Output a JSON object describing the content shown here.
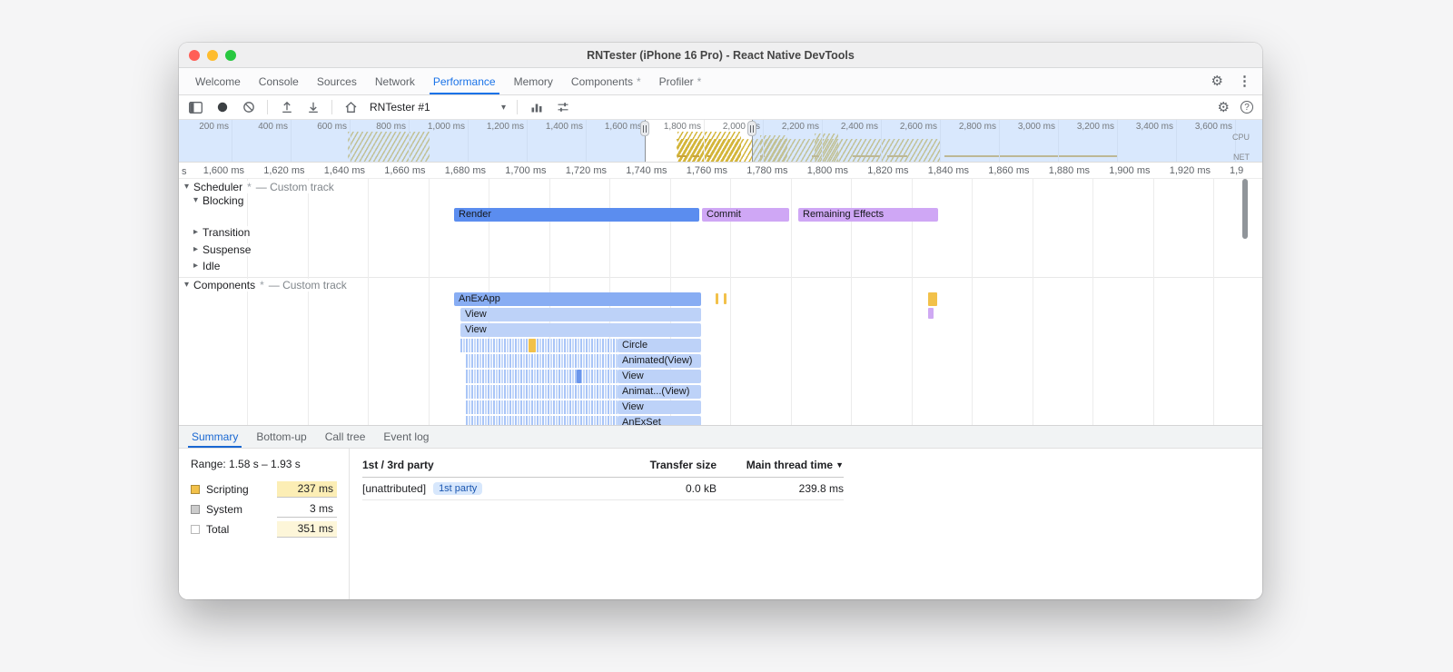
{
  "window": {
    "title": "RNTester (iPhone 16 Pro) - React Native DevTools"
  },
  "devtools_tabs": {
    "badge_char": "*",
    "items": [
      {
        "label": "Welcome"
      },
      {
        "label": "Console"
      },
      {
        "label": "Sources"
      },
      {
        "label": "Network"
      },
      {
        "label": "Performance",
        "selected": true
      },
      {
        "label": "Memory"
      },
      {
        "label": "Components",
        "badge": true
      },
      {
        "label": "Profiler",
        "badge": true
      }
    ]
  },
  "toolbar": {
    "target_select": "RNTester #1",
    "caret": "▾"
  },
  "icons": {
    "settings": "⚙",
    "more": "⋮",
    "help": "?"
  },
  "overview": {
    "cpu_label": "CPU",
    "net_label": "NET",
    "ticks": [
      "200 ms",
      "400 ms",
      "600 ms",
      "800 ms",
      "1,000 ms",
      "1,200 ms",
      "1,400 ms",
      "1,600 ms",
      "1,800 ms",
      "2,000 ms",
      "2,200 ms",
      "2,400 ms",
      "2,600 ms",
      "2,800 ms",
      "3,000 ms",
      "3,200 ms",
      "3,400 ms",
      "3,600 ms"
    ]
  },
  "ruler": {
    "ticks": [
      "1,600 ms",
      "1,620 ms",
      "1,640 ms",
      "1,660 ms",
      "1,680 ms",
      "1,700 ms",
      "1,720 ms",
      "1,740 ms",
      "1,760 ms",
      "1,780 ms",
      "1,800 ms",
      "1,820 ms",
      "1,840 ms",
      "1,860 ms",
      "1,880 ms",
      "1,900 ms",
      "1,920 ms",
      "1,9"
    ]
  },
  "tracks": {
    "timings_clipped_label": "s",
    "glyphs": {
      "caret_down": "▾",
      "caret_right": "▸"
    },
    "scheduler": {
      "name": "Scheduler",
      "suffix": "— Custom track",
      "rows": [
        {
          "label": "Blocking",
          "expanded": true
        },
        {
          "label": "Transition",
          "expanded": false
        },
        {
          "label": "Suspense",
          "expanded": false
        },
        {
          "label": "Idle",
          "expanded": false
        }
      ],
      "bars": [
        {
          "label": "Render"
        },
        {
          "label": "Commit"
        },
        {
          "label": "Remaining Effects"
        }
      ]
    },
    "components": {
      "name": "Components",
      "suffix": "— Custom track"
    },
    "flame": {
      "root": "AnExApp",
      "level2": "View",
      "level3": "View",
      "labels": [
        "Circle",
        "Animated(View)",
        "View",
        "Animat...(View)",
        "View",
        "AnExSet"
      ]
    }
  },
  "bottom_tabs": {
    "items": [
      {
        "label": "Summary",
        "selected": true
      },
      {
        "label": "Bottom-up"
      },
      {
        "label": "Call tree"
      },
      {
        "label": "Event log"
      }
    ]
  },
  "summary": {
    "range": "Range: 1.58 s – 1.93 s",
    "legend": [
      {
        "label": "Scripting",
        "value": "237 ms",
        "swatch": "#f2c14a",
        "value_bg": "#fceeb5"
      },
      {
        "label": "System",
        "value": "3 ms",
        "swatch": "#cccccc",
        "value_bg": ""
      },
      {
        "label": "Total",
        "value": "351 ms",
        "swatch": "#ffffff",
        "value_bg": "#fdf6d9"
      }
    ],
    "table": {
      "col1": "1st / 3rd party",
      "col2": "Transfer size",
      "col3": "Main thread time",
      "sort_indicator": "▼",
      "rows": [
        {
          "entity": "[unattributed]",
          "badge": "1st party",
          "transfer": "0.0 kB",
          "time": "239.8 ms"
        }
      ]
    }
  },
  "colors": {
    "accent": "#1a73e8",
    "scripting_yellow": "#f2c14a",
    "render_bar": "#5b8def",
    "commit_bar": "#cfa7f5",
    "effects_bar": "#cfa7f5",
    "flame_root": "#88adf3",
    "flame_light": "#bdd2f8",
    "first_party_chip_bg": "#d7e7fc"
  }
}
